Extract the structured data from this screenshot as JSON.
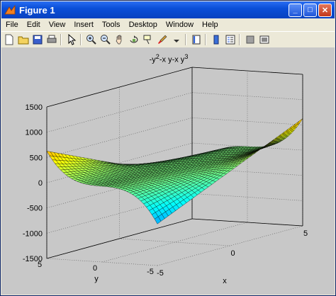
{
  "window": {
    "title": "Figure 1",
    "controls": [
      "_",
      "□",
      "✕"
    ]
  },
  "menu": [
    "File",
    "Edit",
    "View",
    "Insert",
    "Tools",
    "Desktop",
    "Window",
    "Help"
  ],
  "toolbar": {
    "icons": [
      "new-file-icon",
      "open-folder-icon",
      "save-icon",
      "print-icon",
      "pointer-arrow-icon",
      "zoom-in-icon",
      "zoom-out-icon",
      "pan-hand-icon",
      "rotate-3d-icon",
      "data-cursor-icon",
      "brush-icon",
      "link-icon",
      "colorbar-icon",
      "legend-icon",
      "hide-plot-tools-icon",
      "show-plot-tools-icon"
    ]
  },
  "plot": {
    "title_main": "-y",
    "title_sup1": "2",
    "title_mid": "-x y-x y",
    "title_sup2": "3",
    "xlabel": "x",
    "ylabel": "y",
    "background": "#c8c8c8",
    "colormap": "jet"
  },
  "chart_data": {
    "type": "surface",
    "title": "-y^2-x y-x y^3",
    "xlabel": "x",
    "ylabel": "y",
    "x_range": [
      -5,
      5
    ],
    "y_range": [
      -5,
      5
    ],
    "z_range": [
      -1500,
      1500
    ],
    "z_ticks": [
      -1500,
      -1000,
      -500,
      0,
      500,
      1000,
      1500
    ],
    "x_ticks": [
      -5,
      0,
      5
    ],
    "y_ticks": [
      -5,
      0,
      5
    ],
    "grid": true,
    "function": "z = -y^2 - x*y - x*y^3"
  }
}
